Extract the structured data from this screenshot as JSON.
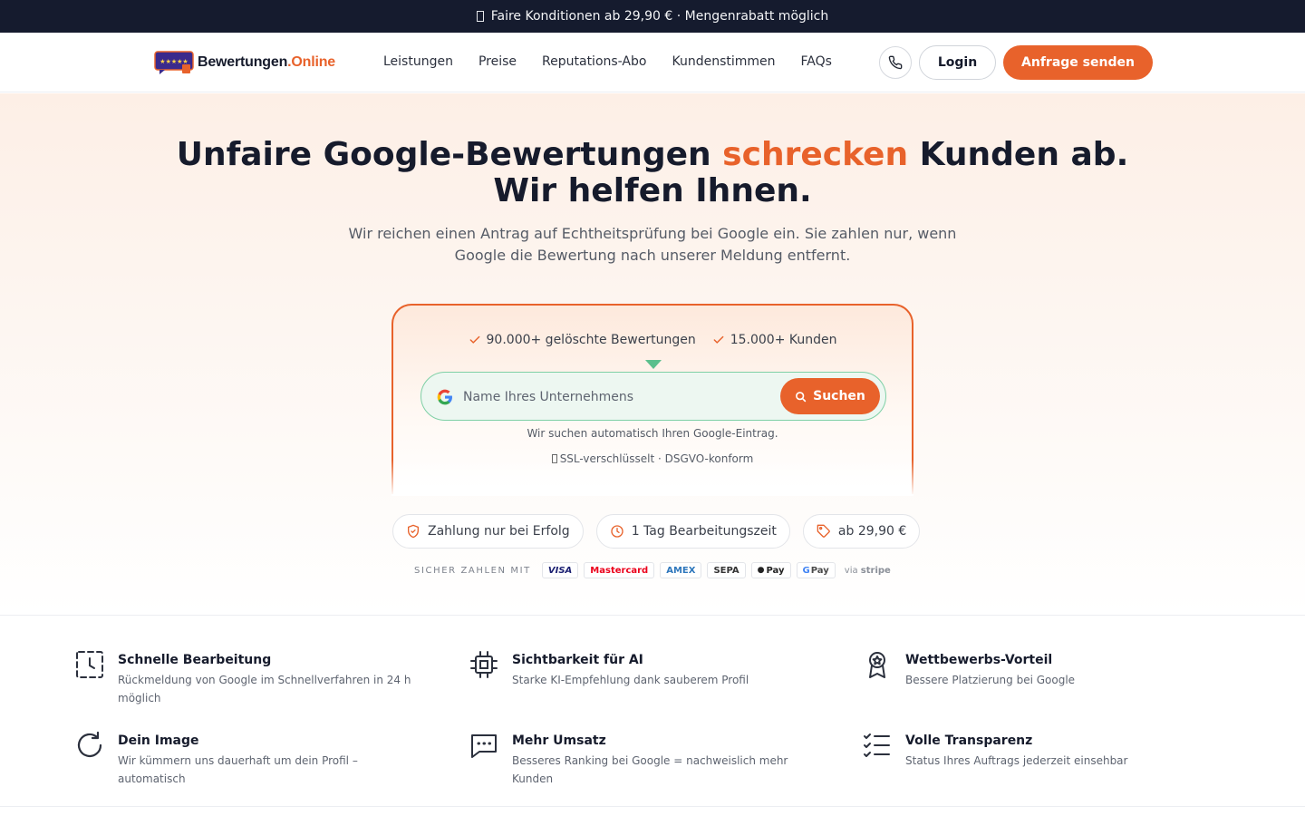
{
  "announcement": {
    "text": "Faire Konditionen ab 29,90 € · Mengenrabatt möglich"
  },
  "header": {
    "logo_name": "Bewertungen",
    "logo_suffix": ".Online",
    "nav": [
      {
        "label": "Leistungen"
      },
      {
        "label": "Preise"
      },
      {
        "label": "Reputations-Abo"
      },
      {
        "label": "Kundenstimmen"
      },
      {
        "label": "FAQs"
      }
    ],
    "phone_icon": "phone-icon",
    "login_label": "Login",
    "cta_label": "Anfrage senden"
  },
  "hero": {
    "title_before": "Unfaire Google-Bewertungen ",
    "title_accent": "schrecken",
    "title_after": " Kunden ab.",
    "title_line2": "Wir helfen Ihnen.",
    "subtitle": "Wir reichen einen Antrag auf Echtheitsprüfung bei Google ein. Sie zahlen nur, wenn Google die Bewertung nach unserer Meldung entfernt."
  },
  "search_card": {
    "stats": [
      {
        "label": "90.000+ gelöschte Bewertungen"
      },
      {
        "label": "15.000+ Kunden"
      }
    ],
    "input_placeholder": "Name Ihres Unternehmens",
    "input_value": "",
    "button_label": "Suchen",
    "hint": "Wir suchen automatisch Ihren Google-Eintrag.",
    "security_note": "SSL-verschlüsselt · DSGVO-konform"
  },
  "badges": [
    {
      "label": "Zahlung nur bei Erfolg",
      "icon": "shield-check-icon"
    },
    {
      "label": "1 Tag Bearbeitungszeit",
      "icon": "clock-icon"
    },
    {
      "label": "ab 29,90 €",
      "icon": "tag-icon"
    }
  ],
  "payment": {
    "label": "SICHER ZAHLEN MIT",
    "methods": [
      {
        "label": "VISA",
        "color": "#1a1f71"
      },
      {
        "label": "Mastercard",
        "color": "#eb001b"
      },
      {
        "label": "AMEX",
        "color": "#2e77bc"
      },
      {
        "label": "SEPA",
        "color": "#333333"
      },
      {
        "label": "Pay",
        "color": "#222222"
      },
      {
        "label": "Pay",
        "color": "#4a4a4a"
      }
    ],
    "via_prefix": "via",
    "via_provider": "stripe"
  },
  "features": [
    {
      "title": "Schnelle Bearbeitung",
      "desc": "Rückmeldung von Google im Schnellverfahren in 24 h möglich",
      "icon": "clock-frame-icon"
    },
    {
      "title": "Sichtbarkeit für AI",
      "desc": "Starke KI-Empfehlung dank sauberem Profil",
      "icon": "chip-icon"
    },
    {
      "title": "Wettbewerbs-Vorteil",
      "desc": "Bessere Platzierung bei Google",
      "icon": "award-icon"
    },
    {
      "title": "Dein Image",
      "desc": "Wir kümmern uns dauerhaft um dein Profil – automatisch",
      "icon": "refresh-icon"
    },
    {
      "title": "Mehr Umsatz",
      "desc": "Besseres Ranking bei Google = nachweislich mehr Kunden",
      "icon": "message-icon"
    },
    {
      "title": "Volle Transparenz",
      "desc": "Status Ihres Auftrags jederzeit einsehbar",
      "icon": "checklist-icon"
    }
  ],
  "colors": {
    "accent": "#e8622b",
    "dark": "#151b2e",
    "success": "#5bbf8d"
  }
}
